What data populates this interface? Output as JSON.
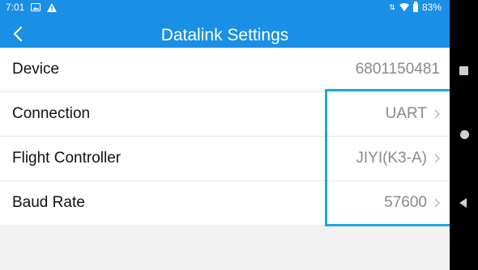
{
  "status_bar": {
    "time": "7:01",
    "battery": "83%"
  },
  "header": {
    "title": "Datalink Settings",
    "back_icon": "chevron-left-icon"
  },
  "rows": [
    {
      "label": "Device",
      "value": "6801150481",
      "has_chevron": false
    },
    {
      "label": "Connection",
      "value": "UART",
      "has_chevron": true
    },
    {
      "label": "Flight Controller",
      "value": "JIYI(K3-A)",
      "has_chevron": true
    },
    {
      "label": "Baud Rate",
      "value": "57600",
      "has_chevron": true
    }
  ],
  "colors": {
    "header_bg": "#1a8fe6",
    "highlight_border": "#1ea7e1",
    "value_text": "#8a8a8a",
    "screen_bg": "#f2f2f2"
  }
}
